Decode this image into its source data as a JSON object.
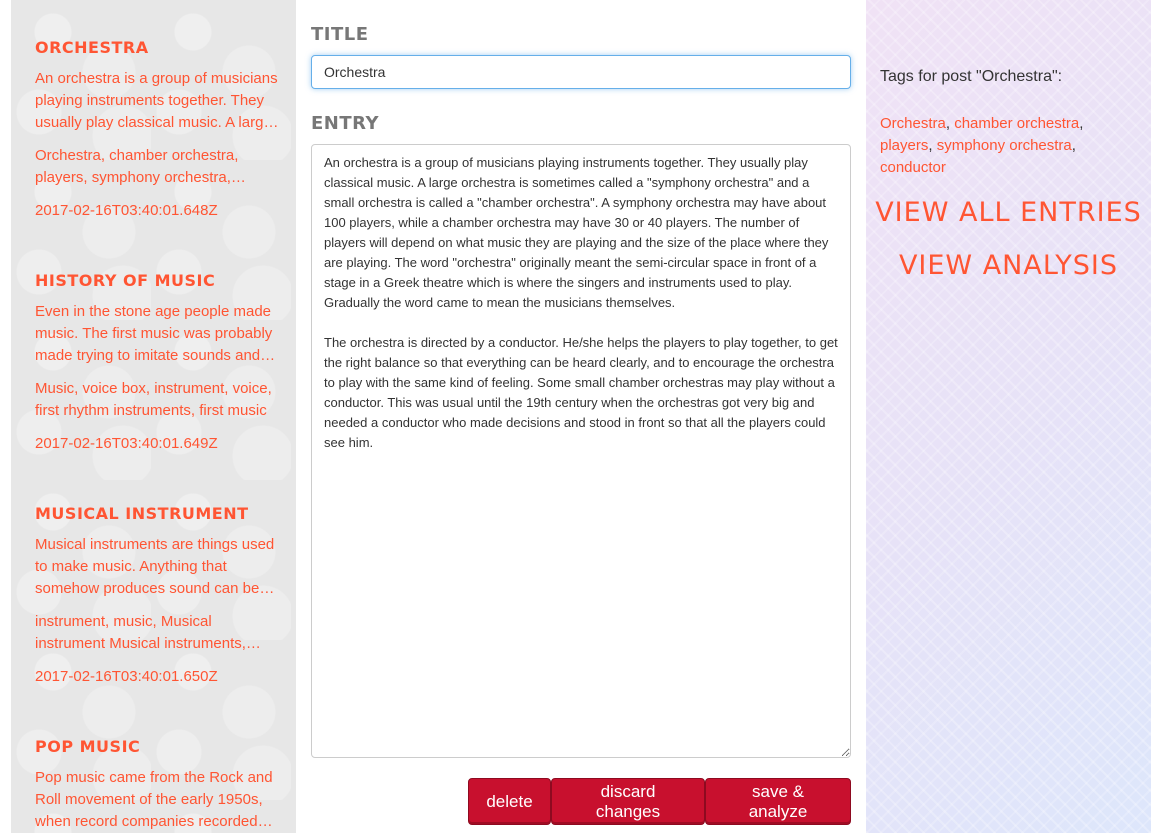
{
  "posts": [
    {
      "title": "Orchestra",
      "excerpt": "An orchestra is a group of musicians playing instruments together. They usually play classical music. A large orchestra is sometimes called a \"symphony orchestra\"",
      "tags": "Orchestra, chamber orchestra, players, symphony orchestra, conductor",
      "date": "2017-02-16T03:40:01.648Z"
    },
    {
      "title": "History of Music",
      "excerpt": "Even in the stone age people made music. The first music was probably made trying to imitate sounds and rhythms",
      "tags": "Music, voice box, instrument, voice, first rhythm instruments, first music",
      "date": "2017-02-16T03:40:01.649Z"
    },
    {
      "title": "Musical Instrument",
      "excerpt": "Musical instruments are things used to make music. Anything that somehow produces sound can be considered a musical instrument",
      "tags": "instrument, music, Musical instrument Musical instruments, sound",
      "date": "2017-02-16T03:40:01.650Z"
    },
    {
      "title": "Pop Music",
      "excerpt": "Pop music came from the Rock and Roll movement of the early 1950s, when record companies recorded songs",
      "tags": "",
      "date": ""
    }
  ],
  "editor": {
    "title_label": "Title",
    "title_value": "Orchestra",
    "entry_label": "Entry",
    "entry_value": "An orchestra is a group of musicians playing instruments together. They usually play classical music. A large orchestra is sometimes called a \"symphony orchestra\" and a small orchestra is called a \"chamber orchestra\". A symphony orchestra may have about 100 players, while a chamber orchestra may have 30 or 40 players. The number of players will depend on what music they are playing and the size of the place where they are playing. The word \"orchestra\" originally meant the semi-circular space in front of a stage in a Greek theatre which is where the singers and instruments used to play. Gradually the word came to mean the musicians themselves.\n\nThe orchestra is directed by a conductor. He/she helps the players to play together, to get the right balance so that everything can be heard clearly, and to encourage the orchestra to play with the same kind of feeling. Some small chamber orchestras may play without a conductor. This was usual until the 19th century when the orchestras got very big and needed a conductor who made decisions and stood in front so that all the players could see him.",
    "buttons": {
      "delete": "delete",
      "discard": "discard changes",
      "save": "save & analyze"
    }
  },
  "tags_panel": {
    "heading": "Tags for post \"Orchestra\":",
    "tags": [
      "Orchestra",
      "chamber orchestra",
      "players",
      "symphony orchestra",
      "conductor"
    ],
    "view_all": "View All Entries",
    "view_analysis": "View Analysis"
  },
  "colors": {
    "accent": "#ff5533",
    "button": "#c8102e"
  }
}
